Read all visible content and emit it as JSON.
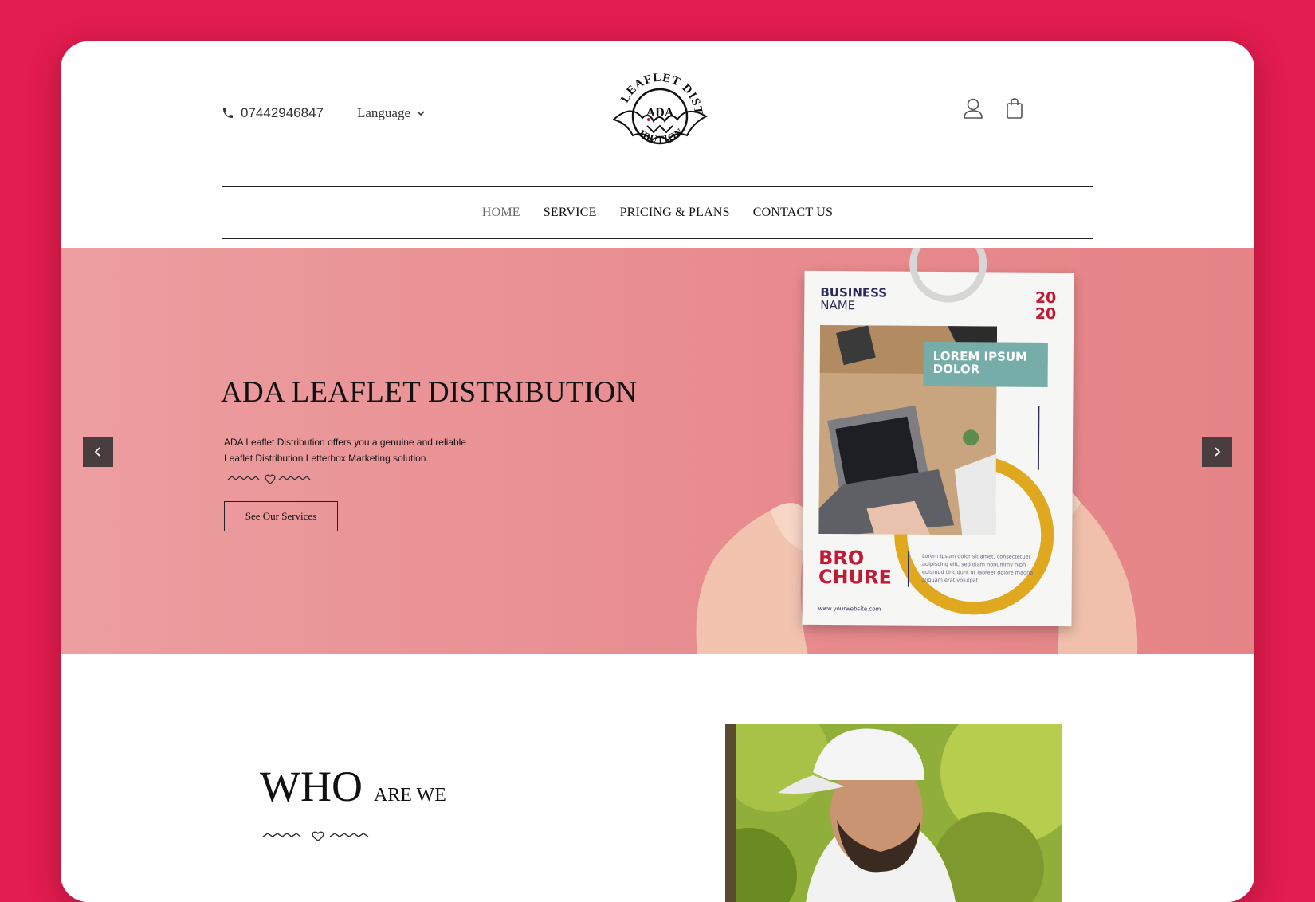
{
  "header": {
    "phone": "07442946847",
    "language_label": "Language",
    "logo_text_top": "LEAFLET DISTRIBUTION",
    "logo_text_center": "ADA"
  },
  "nav": {
    "items": [
      {
        "label": "HOME",
        "active": true
      },
      {
        "label": "SERVICE",
        "active": false
      },
      {
        "label": "PRICING & PLANS",
        "active": false
      },
      {
        "label": "CONTACT US",
        "active": false
      }
    ]
  },
  "hero": {
    "title": "ADA LEAFLET DISTRIBUTION",
    "description": "ADA Leaflet Distribution offers you a genuine and reliable Leaflet Distribution Letterbox Marketing solution.",
    "button_label": "See Our Services",
    "brochure": {
      "business": "BUSINESS",
      "name": "NAME",
      "year_top": "20",
      "year_bottom": "20",
      "lorem": "LOREM IPSUM DOLOR",
      "bro": "BRO",
      "chure": "CHURE",
      "body": "Lorem ipsum dolor sit amet, consectetuer adipiscing elit, sed diam nonummy nibh euismod tincidunt ut laoreet dolore magna aliquam erat volutpat.",
      "website": "www.yourwebsite.com"
    }
  },
  "about": {
    "title_big": "WHO",
    "title_small": "ARE WE"
  },
  "colors": {
    "background": "#e21c4e",
    "hero_pink": "#e88c90",
    "arrow_bg": "#4a3d3f",
    "brochure_red": "#c21a35",
    "brochure_teal": "#77ada8",
    "brochure_yellow": "#e0a81e"
  },
  "icons": {
    "phone": "phone-icon",
    "language_chevron": "chevron-down-icon",
    "user": "user-icon",
    "cart": "shopping-bag-icon",
    "prev": "chevron-left-icon",
    "next": "chevron-right-icon"
  }
}
